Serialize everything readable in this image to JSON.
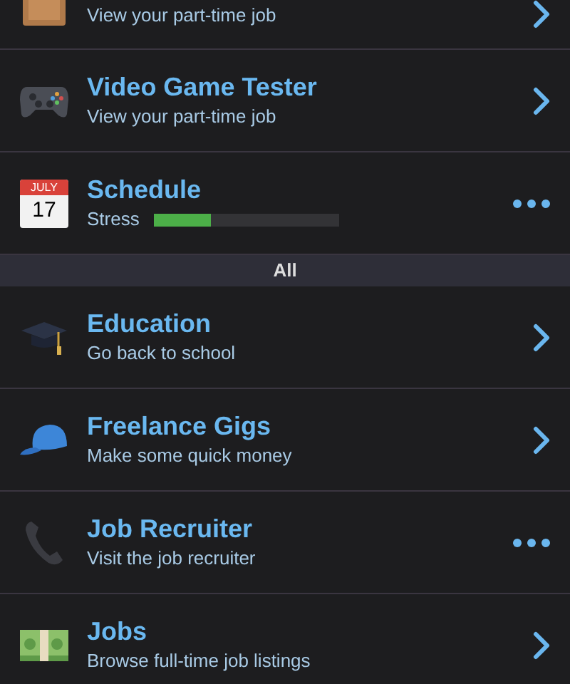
{
  "sections": [
    {
      "items": [
        {
          "subtitle": "View your part-time job",
          "kind": "chevron"
        },
        {
          "title": "Video Game Tester",
          "subtitle": "View your part-time job",
          "kind": "chevron"
        },
        {
          "title": "Schedule",
          "meter": {
            "label": "Stress",
            "level": 0.31
          },
          "calendar": {
            "month": "JULY",
            "day": "17"
          },
          "kind": "more"
        }
      ]
    },
    {
      "header": "All",
      "items": [
        {
          "title": "Education",
          "subtitle": "Go back to school",
          "kind": "chevron"
        },
        {
          "title": "Freelance Gigs",
          "subtitle": "Make some quick money",
          "kind": "chevron"
        },
        {
          "title": "Job Recruiter",
          "subtitle": "Visit the job recruiter",
          "kind": "more"
        },
        {
          "title": "Jobs",
          "subtitle": "Browse full-time job listings",
          "kind": "chevron"
        }
      ]
    }
  ]
}
